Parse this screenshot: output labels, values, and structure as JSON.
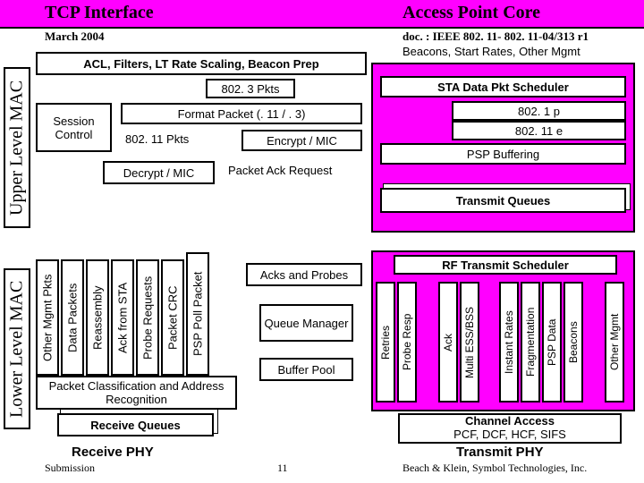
{
  "header": {
    "tcp": "TCP Interface",
    "apcore": "Access Point Core",
    "march": "March 2004",
    "doc": "doc. : IEEE 802. 11- 802. 11-04/313 r1"
  },
  "side": {
    "upper": "Upper Level MAC",
    "lower": "Lower Level MAC"
  },
  "upper": {
    "acl": "ACL, Filters, LT Rate Scaling, Beacon Prep",
    "beacons": "Beacons, Start Rates, Other Mgmt",
    "p8023": "802. 3 Pkts",
    "session": "Session Control",
    "format": "Format Packet (. 11 / . 3)",
    "p80211": "802. 11 Pkts",
    "encrypt": "Encrypt / MIC",
    "decrypt": "Decrypt / MIC",
    "packack": "Packet Ack Request",
    "stasched": "STA Data Pkt Scheduler",
    "p8021p": "802. 1 p",
    "p80211e": "802. 11 e",
    "psp": "PSP Buffering",
    "txq": "Transmit Queues"
  },
  "lowerleft": {
    "c0": "Other Mgmt Pkts",
    "c1": "Data Packets",
    "c2": "Reassembly",
    "c3": "Ack from STA",
    "c4": "Probe Requests",
    "c5": "Packet CRC",
    "c6": "PSP Poll Packet",
    "pcar": "Packet Classification and Address Recognition",
    "rxq": "Receive Queues",
    "rxphy": "Receive PHY"
  },
  "lowermid": {
    "acks": "Acks and Probes",
    "qmgr": "Queue Manager",
    "bpool": "Buffer Pool"
  },
  "lowerright": {
    "rfsched": "RF Transmit Scheduler",
    "c0": "Retries",
    "c1": "Probe Resp",
    "c2": "Ack",
    "c3": "Multi ESS/BSS",
    "c4": "Instant Rates",
    "c5": "Fragmentation",
    "c6": "PSP Data",
    "c7": "Beacons",
    "c8": "Other Mgmt",
    "cacc": "Channel Access",
    "cacc2": "PCF, DCF, HCF, SIFS",
    "txphy": "Transmit PHY"
  },
  "footer": {
    "sub": "Submission",
    "page": "11",
    "auth": "Beach & Klein, Symbol Technologies, Inc."
  }
}
